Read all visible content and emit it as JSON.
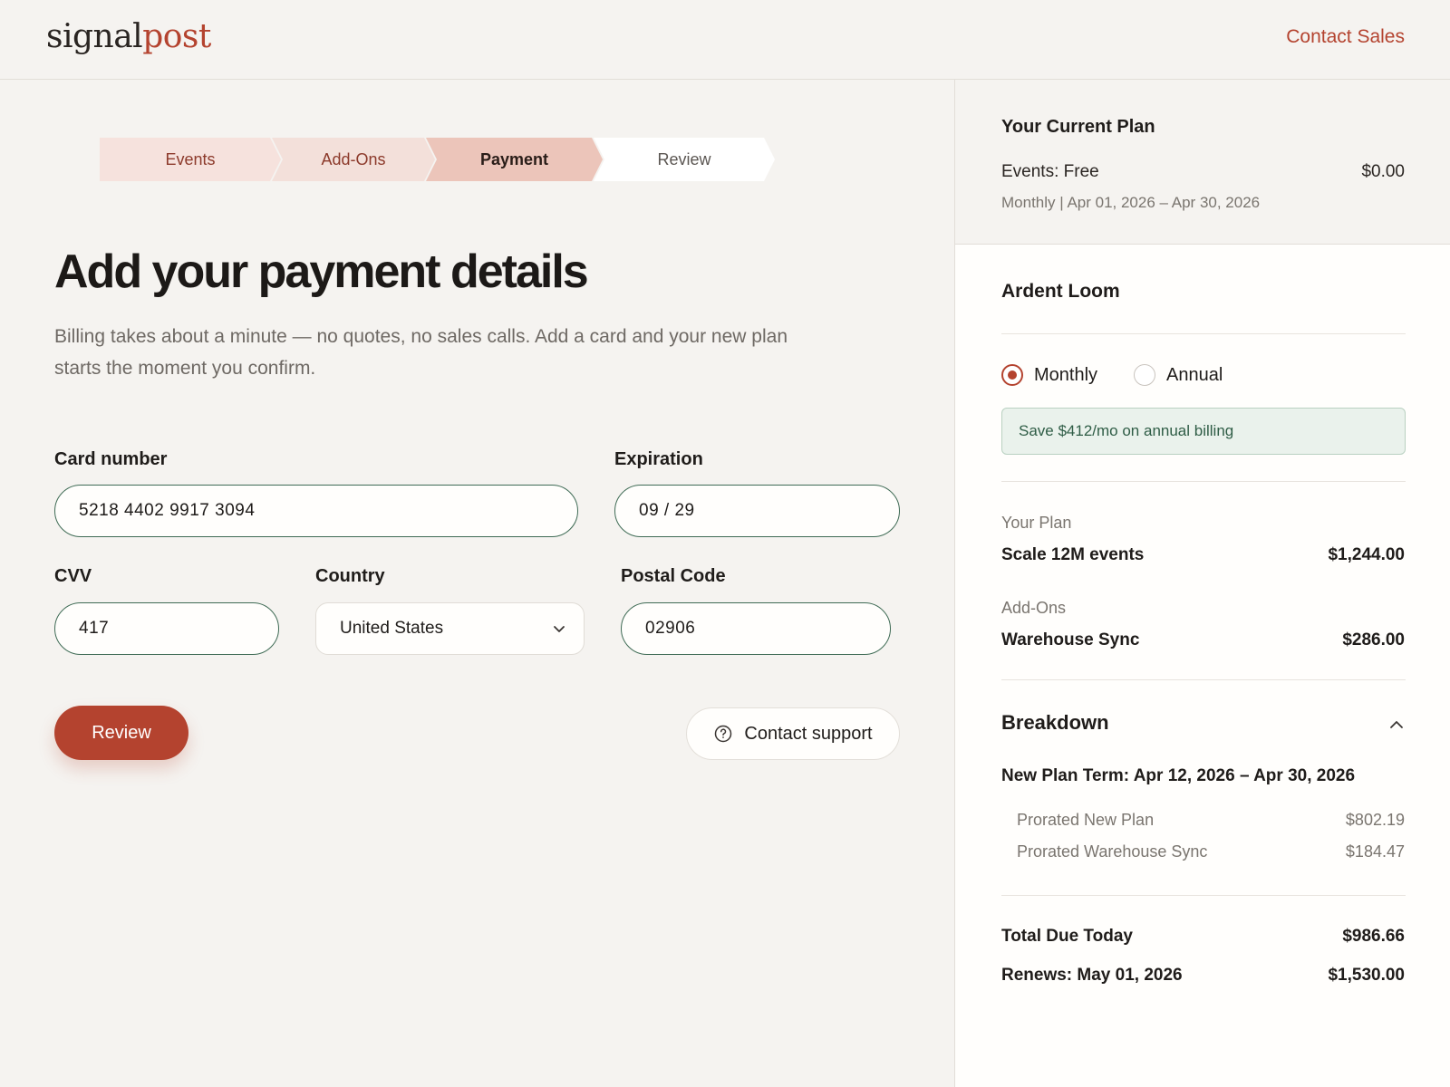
{
  "header": {
    "logo_part1": "signal",
    "logo_part2": "post",
    "contact_sales": "Contact Sales"
  },
  "stepper": {
    "steps": [
      "Events",
      "Add-Ons",
      "Payment",
      "Review"
    ],
    "active": "Payment"
  },
  "main": {
    "title": "Add your payment details",
    "subtitle": "Billing takes about a minute — no quotes, no sales calls. Add a card and your new plan starts the moment you confirm."
  },
  "form": {
    "card_label": "Card number",
    "card_value": "5218 4402 9917 3094",
    "exp_label": "Expiration",
    "exp_value": "09 / 29",
    "cvv_label": "CVV",
    "cvv_value": "417",
    "country_label": "Country",
    "country_value": "United States",
    "postal_label": "Postal Code",
    "postal_value": "02906"
  },
  "actions": {
    "review": "Review",
    "support": "Contact support"
  },
  "current_plan": {
    "title": "Your Current Plan",
    "events": "Events: Free",
    "price": "$0.00",
    "period": "Monthly | Apr 01, 2026 – Apr 30, 2026"
  },
  "summary": {
    "company": "Ardent Loom",
    "billing_options": [
      "Monthly",
      "Annual"
    ],
    "selected_billing": "Monthly",
    "save_note": "Save $412/mo on annual billing",
    "plan_label": "Your Plan",
    "plan_name": "Scale 12M events",
    "plan_price": "$1,244.00",
    "addons_label": "Add-Ons",
    "addon_name": "Warehouse Sync",
    "addon_price": "$286.00",
    "breakdown_title": "Breakdown",
    "term": "New Plan Term: Apr 12, 2026 – Apr 30, 2026",
    "prorated": [
      {
        "label": "Prorated New Plan",
        "value": "$802.19"
      },
      {
        "label": "Prorated Warehouse Sync",
        "value": "$184.47"
      }
    ],
    "total_label": "Total Due Today",
    "total_value": "$986.66",
    "renews_label": "Renews: May 01, 2026",
    "renews_value": "$1,530.00"
  },
  "colors": {
    "accent": "#b4432f",
    "input_border": "#3f6b55",
    "save_bg": "#eaf2ec"
  }
}
